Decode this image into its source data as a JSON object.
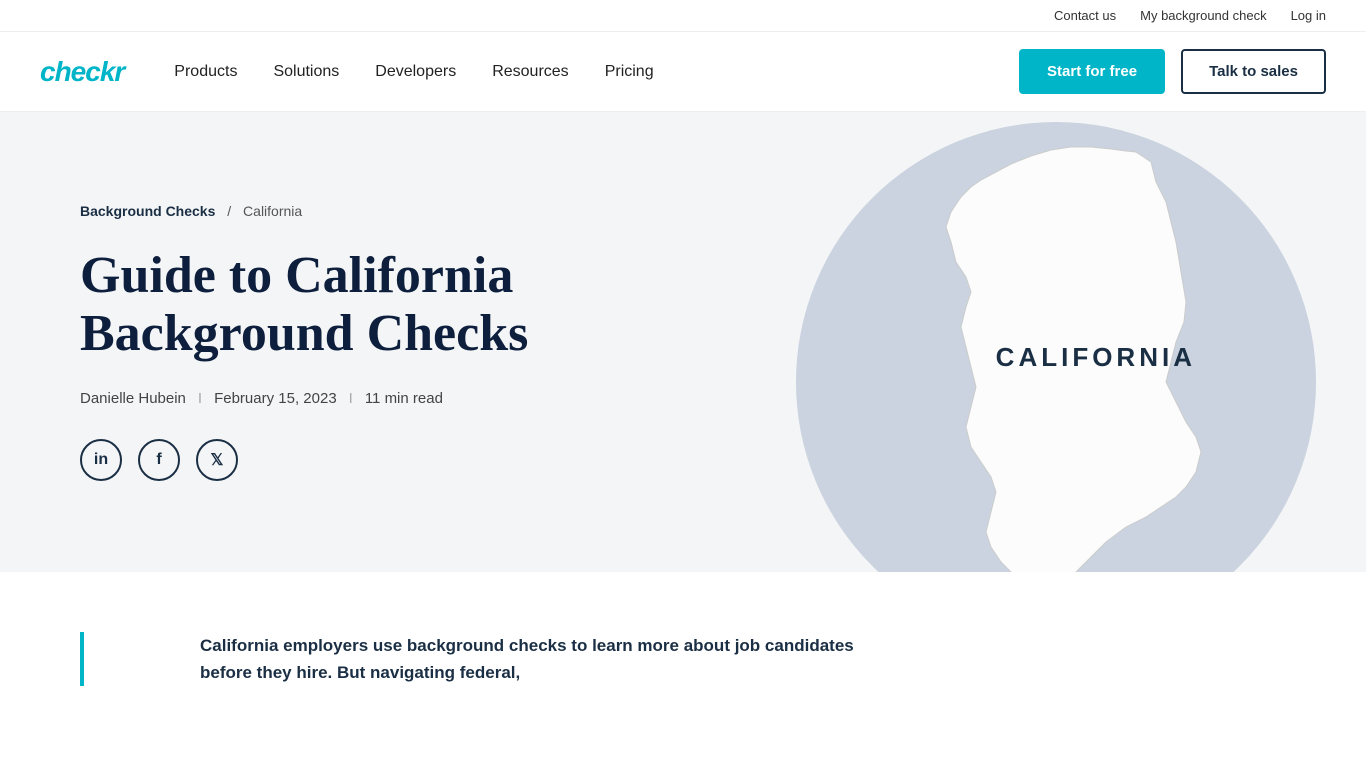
{
  "topbar": {
    "contact_label": "Contact us",
    "bg_check_label": "My background check",
    "login_label": "Log in"
  },
  "navbar": {
    "logo": "checkr",
    "links": [
      {
        "id": "products",
        "label": "Products"
      },
      {
        "id": "solutions",
        "label": "Solutions"
      },
      {
        "id": "developers",
        "label": "Developers"
      },
      {
        "id": "resources",
        "label": "Resources"
      },
      {
        "id": "pricing",
        "label": "Pricing"
      }
    ],
    "cta_primary": "Start for free",
    "cta_secondary": "Talk to sales"
  },
  "breadcrumb": {
    "parent_label": "Background Checks",
    "separator": "/",
    "current": "California"
  },
  "hero": {
    "title": "Guide to California Background Checks",
    "author": "Danielle Hubein",
    "date": "February 15, 2023",
    "read_time": "11 min read",
    "separator": "I",
    "map_label": "CALIFORNIA"
  },
  "social": {
    "linkedin_label": "in",
    "facebook_label": "f",
    "twitter_label": "𝕏"
  },
  "content": {
    "intro": "California employers use background checks to learn more about job candidates before they hire. But navigating federal,"
  }
}
